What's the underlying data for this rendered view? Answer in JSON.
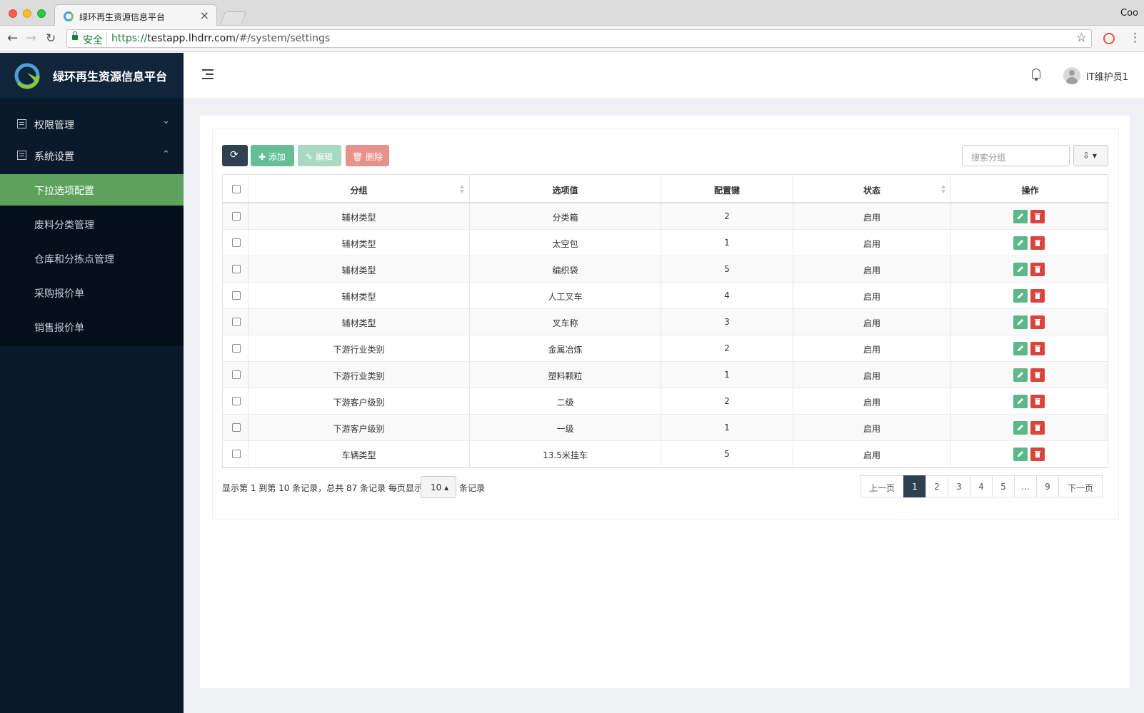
{
  "browser": {
    "tab_title": "绿环再生资源信息平台",
    "tab_close": "×",
    "right_text": "Coo",
    "secure_label": "安全",
    "url_scheme": "https://",
    "url_host": "testapp.lhdrr.com",
    "url_path": "/#/system/settings",
    "nav_back": "←",
    "nav_forward": "→",
    "nav_reload": "↻",
    "star": "☆",
    "menu": "⋮"
  },
  "brand": {
    "title": "绿环再生资源信息平台"
  },
  "sidebar": {
    "groups": [
      {
        "label": "权限管理",
        "arrow": "⌄"
      },
      {
        "label": "系统设置",
        "arrow": "⌃"
      }
    ],
    "sub_items": [
      {
        "label": "下拉选项配置",
        "active": true
      },
      {
        "label": "废料分类管理",
        "active": false
      },
      {
        "label": "仓库和分拣点管理",
        "active": false
      },
      {
        "label": "采购报价单",
        "active": false
      },
      {
        "label": "销售报价单",
        "active": false
      }
    ]
  },
  "topbar": {
    "username": "IT维护员1"
  },
  "toolbar": {
    "refresh_icon": "⟳",
    "add_label": "✚ 添加",
    "edit_label": "✎ 编辑",
    "delete_label": "🗑 删除",
    "search_placeholder": "搜索分组",
    "export_icon": "⇩ ▾"
  },
  "table": {
    "headers": [
      "分组",
      "选项值",
      "配置键",
      "状态",
      "操作"
    ],
    "rows": [
      {
        "group": "辅材类型",
        "value": "分类箱",
        "key": "2",
        "status": "启用"
      },
      {
        "group": "辅材类型",
        "value": "太空包",
        "key": "1",
        "status": "启用"
      },
      {
        "group": "辅材类型",
        "value": "编织袋",
        "key": "5",
        "status": "启用"
      },
      {
        "group": "辅材类型",
        "value": "人工叉车",
        "key": "4",
        "status": "启用"
      },
      {
        "group": "辅材类型",
        "value": "叉车称",
        "key": "3",
        "status": "启用"
      },
      {
        "group": "下游行业类别",
        "value": "金属冶炼",
        "key": "2",
        "status": "启用"
      },
      {
        "group": "下游行业类别",
        "value": "塑料颗粒",
        "key": "1",
        "status": "启用"
      },
      {
        "group": "下游客户级别",
        "value": "二级",
        "key": "2",
        "status": "启用"
      },
      {
        "group": "下游客户级别",
        "value": "一级",
        "key": "1",
        "status": "启用"
      },
      {
        "group": "车辆类型",
        "value": "13.5米挂车",
        "key": "5",
        "status": "启用"
      }
    ]
  },
  "footer": {
    "info": "显示第 1 到第 10 条记录，总共 87 条记录  每页显示",
    "page_size": "10 ▴",
    "info_suffix": "条记录"
  },
  "pagination": {
    "prev": "上一页",
    "pages": [
      "1",
      "2",
      "3",
      "4",
      "5",
      "...",
      "9"
    ],
    "active": "1",
    "next": "下一页"
  },
  "colors": {
    "sidebar_bg": "#0b1a2b",
    "active_menu": "#5da15c",
    "primary_dark": "#2f4050",
    "success": "#64bf96",
    "danger": "#d9453d"
  }
}
